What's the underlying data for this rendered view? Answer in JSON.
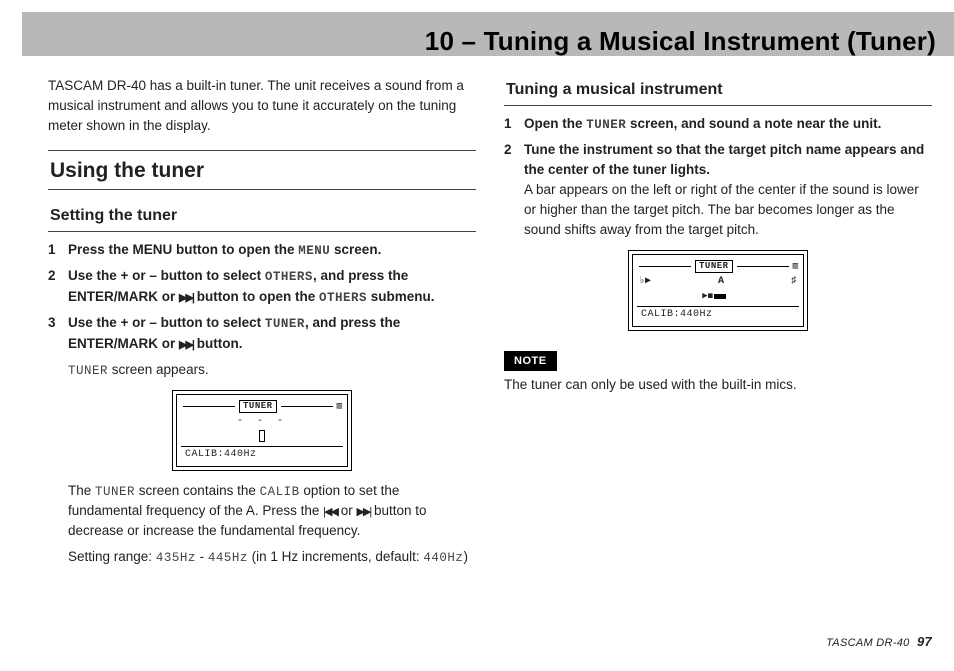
{
  "header": {
    "title": "10 – Tuning a Musical Instrument (Tuner)"
  },
  "footer": {
    "product": "TASCAM DR-40",
    "page": "97"
  },
  "left": {
    "intro": "TASCAM DR-40 has a built-in tuner. The unit receives a sound from a musical instrument and allows you to tune it accurately on the tuning meter shown in the display.",
    "h1": "Using the tuner",
    "h2": "Setting the tuner",
    "step1_a": "Press the MENU button to open the ",
    "step1_mono": "MENU",
    "step1_b": " screen.",
    "step2_a": "Use the + or – button to select ",
    "step2_mono1": "OTHERS",
    "step2_b": ", and press the ENTER/MARK or ",
    "step2_c": " button to open the ",
    "step2_mono2": "OTHERS",
    "step2_d": " submenu.",
    "step3_a": "Use the + or – button to select ",
    "step3_mono1": "TUNER",
    "step3_b": ", and press the ENTER/MARK or ",
    "step3_c": " button.",
    "sub1_mono": "TUNER",
    "sub1_text": " screen appears.",
    "fig1": {
      "title": "TUNER",
      "bat": "▥",
      "row": "- - -",
      "calib": "CALIB:440Hz"
    },
    "sub2_a": "The ",
    "sub2_mono1": "TUNER",
    "sub2_b": " screen contains the ",
    "sub2_mono2": "CALIB",
    "sub2_c": " option to set the fundamental frequency of the A. Press the ",
    "sub2_d": " or ",
    "sub2_e": " button to decrease or increase the fundamental frequency.",
    "sub3_a": "Setting range: ",
    "sub3_mono1": "435Hz",
    "sub3_b": " - ",
    "sub3_mono2": "445Hz",
    "sub3_c": " (in 1 Hz increments, default: ",
    "sub3_mono3": "440Hz",
    "sub3_d": ")"
  },
  "right": {
    "h2": "Tuning a musical instrument",
    "step1_a": "Open the ",
    "step1_mono": "TUNER",
    "step1_b": " screen, and sound a note near the unit.",
    "step2_a": "Tune the instrument so that the target pitch name appears and the center of the tuner lights.",
    "step2_body": "A bar appears on the left or right of the center if the sound is lower or higher than the target pitch. The bar becomes longer as the sound shifts away from the target pitch.",
    "fig2": {
      "title": "TUNER",
      "bat": "▥",
      "row_left": "♭▶",
      "row_note": "A",
      "row_right": "♯",
      "calib": "CALIB:440Hz"
    },
    "note_label": "NOTE",
    "note_text": "The tuner can only be used with the built-in mics."
  },
  "glyphs": {
    "ffwd": "▶▶",
    "rrew": "◀◀",
    "ffwd_bar": "▶▶|",
    "rrew_bar": "|◀◀"
  }
}
